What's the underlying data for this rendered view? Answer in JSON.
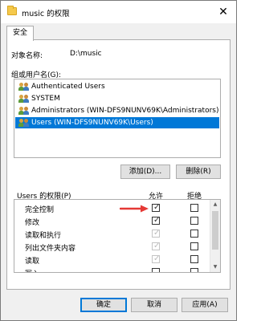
{
  "window": {
    "title": "music 的权限",
    "close_glyph": "✕"
  },
  "tabs": [
    {
      "label": "安全"
    }
  ],
  "object": {
    "label": "对象名称:",
    "value": "D:\\music"
  },
  "groups": {
    "label": "组或用户名(G):",
    "items": [
      {
        "label": "Authenticated Users",
        "icon": "users-group-icon",
        "selected": false
      },
      {
        "label": "SYSTEM",
        "icon": "users-group-icon",
        "selected": false
      },
      {
        "label": "Administrators (WIN-DFS9NUNV69K\\Administrators)",
        "icon": "users-group-icon",
        "selected": false
      },
      {
        "label": "Users (WIN-DFS9NUNV69K\\Users)",
        "icon": "users-group-icon",
        "selected": true
      }
    ]
  },
  "buttons": {
    "add": "添加(D)...",
    "remove": "删除(R)",
    "ok": "确定",
    "cancel": "取消",
    "apply": "应用(A)"
  },
  "permissions": {
    "label": "Users 的权限(P)",
    "allow_header": "允许",
    "deny_header": "拒绝",
    "rows": [
      {
        "name": "完全控制",
        "allow": true,
        "allow_disabled": false,
        "deny": false,
        "deny_disabled": false
      },
      {
        "name": "修改",
        "allow": true,
        "allow_disabled": false,
        "deny": false,
        "deny_disabled": false
      },
      {
        "name": "读取和执行",
        "allow": true,
        "allow_disabled": true,
        "deny": false,
        "deny_disabled": false
      },
      {
        "name": "列出文件夹内容",
        "allow": true,
        "allow_disabled": true,
        "deny": false,
        "deny_disabled": false
      },
      {
        "name": "读取",
        "allow": true,
        "allow_disabled": true,
        "deny": false,
        "deny_disabled": false
      },
      {
        "name": "写入",
        "allow": false,
        "allow_disabled": false,
        "deny": false,
        "deny_disabled": false
      }
    ]
  },
  "colors": {
    "accent": "#0078d7",
    "annotation_arrow": "#e53935"
  }
}
